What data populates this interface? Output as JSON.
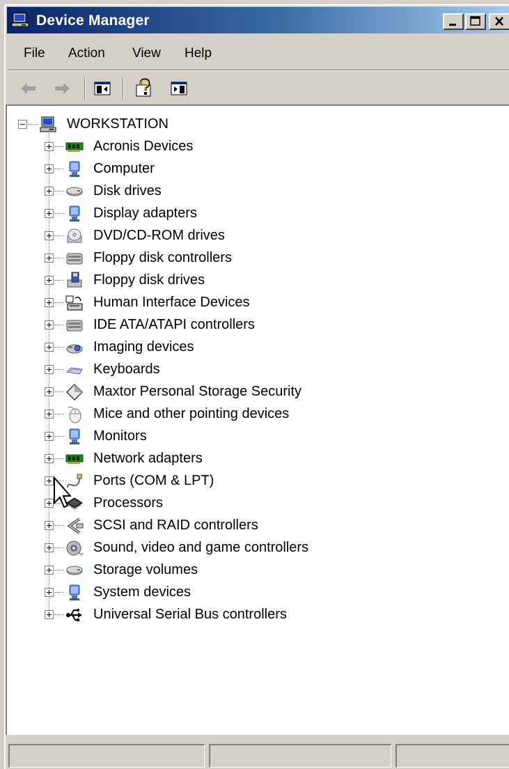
{
  "window": {
    "title": "Device Manager"
  },
  "menu": [
    "File",
    "Action",
    "View",
    "Help"
  ],
  "toolbar": {
    "buttons": [
      "back-arrow-icon",
      "forward-arrow-icon",
      "show-hide-console-tree-icon",
      "help-icon",
      "show-hide-action-pane-icon"
    ]
  },
  "tree": {
    "root": {
      "label": "WORKSTATION",
      "icon": "computer-icon"
    },
    "items": [
      {
        "label": "Acronis Devices",
        "icon": "circuit-board-icon"
      },
      {
        "label": "Computer",
        "icon": "monitor-icon"
      },
      {
        "label": "Disk drives",
        "icon": "disk-drive-icon"
      },
      {
        "label": "Display adapters",
        "icon": "monitor-icon"
      },
      {
        "label": "DVD/CD-ROM drives",
        "icon": "cd-drive-icon"
      },
      {
        "label": "Floppy disk controllers",
        "icon": "controller-icon"
      },
      {
        "label": "Floppy disk drives",
        "icon": "floppy-drive-icon"
      },
      {
        "label": "Human Interface Devices",
        "icon": "hid-icon"
      },
      {
        "label": "IDE ATA/ATAPI controllers",
        "icon": "controller-icon"
      },
      {
        "label": "Imaging devices",
        "icon": "camera-icon"
      },
      {
        "label": "Keyboards",
        "icon": "keyboard-icon"
      },
      {
        "label": "Maxtor Personal Storage Security",
        "icon": "diamond-icon"
      },
      {
        "label": "Mice and other pointing devices",
        "icon": "mouse-icon"
      },
      {
        "label": "Monitors",
        "icon": "monitor-icon"
      },
      {
        "label": "Network adapters",
        "icon": "circuit-board-icon"
      },
      {
        "label": "Ports (COM & LPT)",
        "icon": "port-icon"
      },
      {
        "label": "Processors",
        "icon": "processor-icon"
      },
      {
        "label": "SCSI and RAID controllers",
        "icon": "scsi-icon"
      },
      {
        "label": "Sound, video and game controllers",
        "icon": "speaker-icon"
      },
      {
        "label": "Storage volumes",
        "icon": "disk-drive-icon"
      },
      {
        "label": "System devices",
        "icon": "monitor-icon"
      },
      {
        "label": "Universal Serial Bus controllers",
        "icon": "usb-icon"
      }
    ]
  },
  "colors": {
    "titlebar_start": "#0a246a",
    "titlebar_end": "#a6caf0",
    "chrome": "#d4d0c8"
  }
}
